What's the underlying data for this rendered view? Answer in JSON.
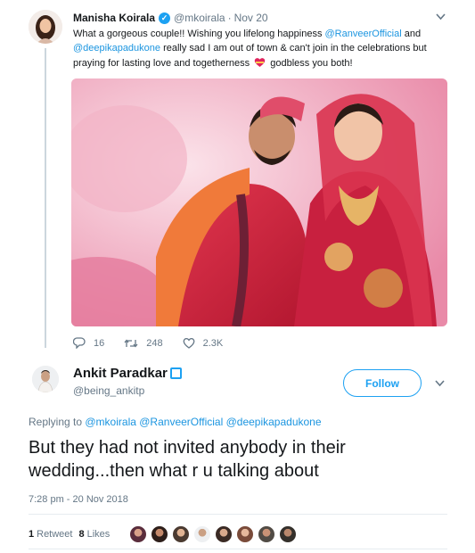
{
  "parent_tweet": {
    "author_name": "Manisha Koirala",
    "handle": "@mkoirala",
    "separator": "·",
    "date": "Nov 20",
    "text_part1": "What a gorgeous couple!! Wishing you  lifelong happiness ",
    "mention1": "@RanveerOfficial",
    "text_part2": "  and ",
    "mention2": "@deepikapadukone",
    "text_part3": " really sad I am out of town & can't join in the celebrations but praying for lasting love and togetherness ",
    "text_part4": " godbless you both!",
    "replies": "16",
    "retweets": "248",
    "likes": "2.3K"
  },
  "reply_tweet": {
    "author_name": "Ankit Paradkar",
    "handle": "@being_ankitp",
    "follow_label": "Follow",
    "replying_label": "Replying to ",
    "replying_mentions": [
      "@mkoirala",
      "@RanveerOfficial",
      "@deepikapadukone"
    ],
    "text": "But they had not invited anybody in their wedding...then what r u talking about",
    "timestamp": "7:28 pm - 20 Nov 2018",
    "retweets_count": "1",
    "retweets_label": "Retweet",
    "likes_count": "8",
    "likes_label": "Likes"
  },
  "colors": {
    "link": "#1b95e0",
    "accent": "#1da1f2",
    "muted": "#657786",
    "text": "#14171a"
  },
  "icons": [
    "verified-icon",
    "caret-down-icon",
    "reply-icon",
    "retweet-icon",
    "like-icon",
    "heart-emoji-icon"
  ]
}
